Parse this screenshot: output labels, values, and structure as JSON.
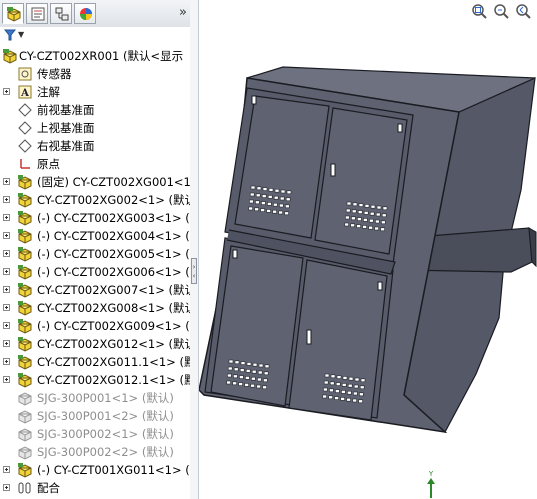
{
  "panel": {
    "tabs": [
      {
        "name": "feature-manager-tab",
        "active": true
      },
      {
        "name": "property-manager-tab",
        "active": false
      },
      {
        "name": "configuration-manager-tab",
        "active": false
      },
      {
        "name": "display-manager-tab",
        "active": false
      }
    ],
    "collapse_label": "»",
    "root": {
      "label": "CY-CZT002XR001  (默认<显示"
    },
    "items": [
      {
        "label": "传感器",
        "icon": "sensor-icon",
        "expand": false,
        "grey": false
      },
      {
        "label": "注解",
        "icon": "annotation-icon",
        "expand": true,
        "grey": false
      },
      {
        "label": "前视基准面",
        "icon": "plane-icon",
        "expand": false,
        "grey": false
      },
      {
        "label": "上视基准面",
        "icon": "plane-icon",
        "expand": false,
        "grey": false
      },
      {
        "label": "右视基准面",
        "icon": "plane-icon",
        "expand": false,
        "grey": false
      },
      {
        "label": "原点",
        "icon": "origin-icon",
        "expand": false,
        "grey": false
      },
      {
        "label": "(固定) CY-CZT002XG001<1",
        "icon": "part-icon",
        "expand": true,
        "grey": false
      },
      {
        "label": "CY-CZT002XG002<1> (默认",
        "icon": "part-icon",
        "expand": true,
        "grey": false
      },
      {
        "label": "(-) CY-CZT002XG003<1> (",
        "icon": "part-icon",
        "expand": true,
        "grey": false
      },
      {
        "label": "(-) CY-CZT002XG004<1> (",
        "icon": "part-icon",
        "expand": true,
        "grey": false
      },
      {
        "label": "(-) CY-CZT002XG005<1> (",
        "icon": "part-icon",
        "expand": true,
        "grey": false
      },
      {
        "label": "(-) CY-CZT002XG006<1> (",
        "icon": "part-icon",
        "expand": true,
        "grey": false
      },
      {
        "label": "CY-CZT002XG007<1> (默认",
        "icon": "part-icon",
        "expand": true,
        "grey": false
      },
      {
        "label": "CY-CZT002XG008<1> (默认",
        "icon": "part-icon",
        "expand": true,
        "grey": false
      },
      {
        "label": "(-) CY-CZT002XG009<1> (",
        "icon": "part-icon",
        "expand": true,
        "grey": false
      },
      {
        "label": "CY-CZT002XG012<1> (默认",
        "icon": "part-icon",
        "expand": true,
        "grey": false
      },
      {
        "label": "CY-CZT002XG011.1<1> (默",
        "icon": "part-icon",
        "expand": true,
        "grey": false
      },
      {
        "label": "CY-CZT002XG012.1<1> (默",
        "icon": "part-icon",
        "expand": true,
        "grey": false
      },
      {
        "label": "SJG-300P001<1> (默认)",
        "icon": "suppressed-part-icon",
        "expand": false,
        "grey": true
      },
      {
        "label": "SJG-300P001<2> (默认)",
        "icon": "suppressed-part-icon",
        "expand": false,
        "grey": true
      },
      {
        "label": "SJG-300P002<1> (默认)",
        "icon": "suppressed-part-icon",
        "expand": false,
        "grey": true
      },
      {
        "label": "SJG-300P002<2> (默认)",
        "icon": "suppressed-part-icon",
        "expand": false,
        "grey": true
      },
      {
        "label": "(-) CY-CZT001XG011<1> (",
        "icon": "part-icon",
        "expand": true,
        "grey": false
      },
      {
        "label": "配合",
        "icon": "mates-icon",
        "expand": true,
        "grey": false
      }
    ]
  },
  "view": {
    "tools": [
      "zoom-to-fit-icon",
      "zoom-area-icon",
      "previous-view-icon"
    ],
    "triad_label": "Y",
    "colors": {
      "body": "#5d6170",
      "edge": "#1a1c22",
      "vent": "#20222a"
    }
  }
}
